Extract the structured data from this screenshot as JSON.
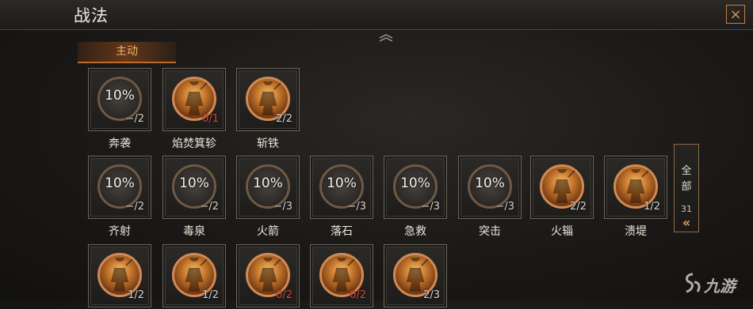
{
  "window": {
    "title": "战法",
    "close_icon": "×"
  },
  "section": {
    "label": "主动"
  },
  "skills": [
    {
      "name": "奔袭",
      "percent": "10%",
      "count": "−/2",
      "unlocked": false,
      "count_red": false
    },
    {
      "name": "焰焚箕轸",
      "percent": "",
      "count": "0/1",
      "unlocked": true,
      "count_red": true
    },
    {
      "name": "斩铁",
      "percent": "",
      "count": "2/2",
      "unlocked": true,
      "count_red": false
    },
    {
      "name": "齐射",
      "percent": "10%",
      "count": "−/2",
      "unlocked": false,
      "count_red": false
    },
    {
      "name": "毒泉",
      "percent": "10%",
      "count": "−/2",
      "unlocked": false,
      "count_red": false
    },
    {
      "name": "火箭",
      "percent": "10%",
      "count": "−/3",
      "unlocked": false,
      "count_red": false
    },
    {
      "name": "落石",
      "percent": "10%",
      "count": "−/3",
      "unlocked": false,
      "count_red": false
    },
    {
      "name": "急救",
      "percent": "10%",
      "count": "−/3",
      "unlocked": false,
      "count_red": false
    },
    {
      "name": "突击",
      "percent": "10%",
      "count": "−/3",
      "unlocked": false,
      "count_red": false
    },
    {
      "name": "火辎",
      "percent": "",
      "count": "2/2",
      "unlocked": true,
      "count_red": false
    },
    {
      "name": "溃堤",
      "percent": "",
      "count": "1/2",
      "unlocked": true,
      "count_red": false
    },
    {
      "name": "",
      "percent": "",
      "count": "1/2",
      "unlocked": true,
      "count_red": false
    },
    {
      "name": "",
      "percent": "",
      "count": "1/2",
      "unlocked": true,
      "count_red": false
    },
    {
      "name": "",
      "percent": "",
      "count": "0/2",
      "unlocked": true,
      "count_red": true
    },
    {
      "name": "",
      "percent": "",
      "count": "0/2",
      "unlocked": true,
      "count_red": true
    },
    {
      "name": "",
      "percent": "",
      "count": "2/3",
      "unlocked": true,
      "count_red": false
    }
  ],
  "side_filter": {
    "line1": "全",
    "line2": "部",
    "count": "31",
    "arrows": "«"
  },
  "watermark": {
    "text": "九游"
  }
}
